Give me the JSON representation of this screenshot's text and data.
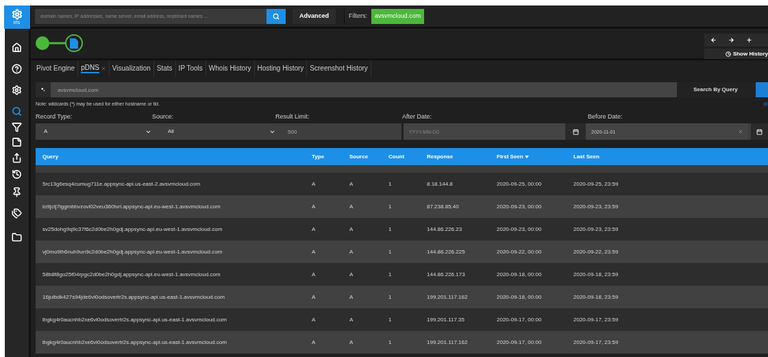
{
  "sidebar": {
    "logo": "Iris",
    "items": [
      {
        "kind": "home",
        "selected": false
      },
      {
        "kind": "help",
        "selected": false
      },
      {
        "kind": "settings",
        "selected": false
      },
      {
        "kind": "search",
        "selected": true
      },
      {
        "kind": "filter",
        "selected": false
      },
      {
        "kind": "note",
        "selected": false
      },
      {
        "kind": "share",
        "selected": false
      },
      {
        "kind": "history",
        "selected": false
      },
      {
        "kind": "pin",
        "selected": false
      },
      {
        "kind": "tags",
        "selected": false
      },
      {
        "kind": "folder",
        "selected": false
      }
    ]
  },
  "top_bar": {
    "search": {
      "placeholder": "domain names, IP addresses, name server, email address, registrant names ..."
    },
    "advanced": "Advanced",
    "filters_label": "Filters:",
    "filter_chip": "avsvmcloud.com"
  },
  "history_controls": {
    "buttons": [
      {
        "kind": "back"
      },
      {
        "kind": "forward"
      },
      {
        "kind": "add"
      }
    ],
    "show_history": "Show History"
  },
  "tabs": [
    {
      "label": "Pivot Engine",
      "selected": false,
      "closable": false
    },
    {
      "label": "pDNS",
      "selected": true,
      "closable": true
    },
    {
      "label": "Visualization",
      "selected": false,
      "closable": false
    },
    {
      "label": "Stats",
      "selected": false,
      "closable": false
    },
    {
      "label": "IP Tools",
      "selected": false,
      "closable": false
    },
    {
      "label": "Whois History",
      "selected": false,
      "closable": false
    },
    {
      "label": "Hosting History",
      "selected": false,
      "closable": false
    },
    {
      "label": "Screenshot History",
      "selected": false,
      "closable": false
    }
  ],
  "query": {
    "prefix": "•.",
    "value": "avsvmcloud.com",
    "button": "Search By Query",
    "note": "Note: wildcards (*) may be used for either hostname or tld.",
    "link": "cl"
  },
  "filters": {
    "record_type": {
      "label": "Record Type:",
      "value": "A"
    },
    "source": {
      "label": "Source:",
      "value": "All"
    },
    "result_limit": {
      "label": "Result Limit:",
      "value": "500"
    },
    "after_date": {
      "label": "After Date:",
      "placeholder": "YYYY-MM-DD"
    },
    "before_date": {
      "label": "Before Date:",
      "value": "2020-11-01"
    }
  },
  "table": {
    "columns": [
      {
        "label": "Query",
        "sorted": false
      },
      {
        "label": "Type",
        "sorted": false
      },
      {
        "label": "Source",
        "sorted": false
      },
      {
        "label": "Count",
        "sorted": false
      },
      {
        "label": "Response",
        "sorted": false
      },
      {
        "label": "First Seen",
        "sorted": true
      },
      {
        "label": "Last Seen",
        "sorted": false
      }
    ],
    "rows": [
      [
        "5rc13g6esq4cumug711e.appsync-api.us-east-2.avsvmcloud.com",
        "A",
        "A",
        "1",
        "8.18.144.8",
        "2020-09-25, 00:00",
        "2020-09-25, 23:59"
      ],
      [
        "lo9jctj7lggmbbvzovi02veu360tvri.appsync-api.eu-west-1.avsvmcloud.com",
        "A",
        "A",
        "1",
        "87.238.85.40",
        "2020-09-23, 00:00",
        "2020-09-23, 23:59"
      ],
      [
        "sv25dohg9q9c37f6c2d0be2h0gdj.appsync-api.eu-west-1.avsvmcloud.com",
        "A",
        "A",
        "1",
        "144.86.226.23",
        "2020-09-23, 00:00",
        "2020-09-23, 23:59"
      ],
      [
        "vj0mo9lh6nuh9un9c2d0be2h0gdj.appsync-api.eu-west-1.avsvmcloud.com",
        "A",
        "A",
        "1",
        "144.86.226.225",
        "2020-09-22, 00:00",
        "2020-09-22, 23:59"
      ],
      [
        "58b8f8go25f04rpgc2d0be2h0gdj.appsync-api.eu-west-1.avsvmcloud.com",
        "A",
        "A",
        "1",
        "144.86.226.173",
        "2020-09-18, 00:00",
        "2020-09-18, 23:59"
      ],
      [
        "16julbdk427s94jde6vi0odsovertr2s.appsync-api.us-east-1.avsvmcloud.com",
        "A",
        "A",
        "1",
        "199.201.117.162",
        "2020-09-18, 00:00",
        "2020-09-18, 23:59"
      ],
      [
        "ibgkg4r0aucnhb2xe6vi0odsovertr2s.appsync-api.us-east-1.avsvmcloud.com",
        "A",
        "A",
        "1",
        "199.201.117.35",
        "2020-09-17, 00:00",
        "2020-09-17, 23:59"
      ],
      [
        "ibgkg4r0aucnhb2xe6vi0odsovertr2s.appsync-api.us-east-1.avsvmcloud.com",
        "A",
        "A",
        "1",
        "199.201.117.162",
        "2020-09-17, 00:00",
        "2020-09-17, 23:59"
      ]
    ]
  }
}
